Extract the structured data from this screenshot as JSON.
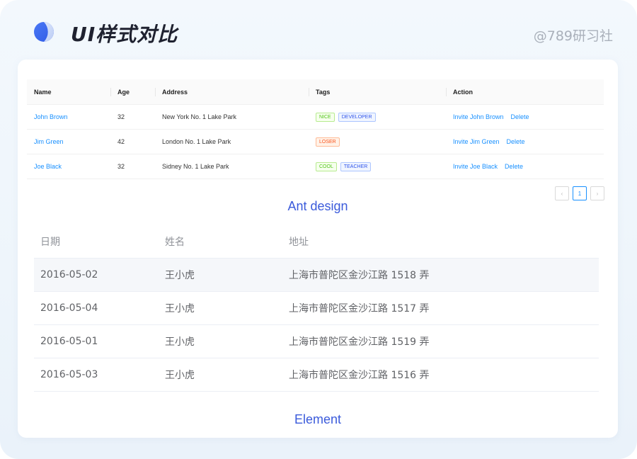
{
  "header": {
    "title": "UI样式对比",
    "credit": "@789研习社",
    "logo": {
      "icon": "half-moon-logo-icon",
      "color": "#3d6cf2"
    }
  },
  "ant": {
    "columns": [
      "Name",
      "Age",
      "Address",
      "Tags",
      "Action"
    ],
    "rows": [
      {
        "name": "John Brown",
        "age": "32",
        "address": "New York No. 1 Lake Park",
        "tags": [
          {
            "label": "NICE",
            "color": "green"
          },
          {
            "label": "DEVELOPER",
            "color": "geekblue"
          }
        ],
        "invite": "Invite John Brown",
        "delete": "Delete"
      },
      {
        "name": "Jim Green",
        "age": "42",
        "address": "London No. 1 Lake Park",
        "tags": [
          {
            "label": "LOSER",
            "color": "volcano"
          }
        ],
        "invite": "Invite Jim Green",
        "delete": "Delete"
      },
      {
        "name": "Joe Black",
        "age": "32",
        "address": "Sidney No. 1 Lake Park",
        "tags": [
          {
            "label": "COOL",
            "color": "green"
          },
          {
            "label": "TEACHER",
            "color": "geekblue"
          }
        ],
        "invite": "Invite Joe Black",
        "delete": "Delete"
      }
    ],
    "pagination": {
      "prev": "‹",
      "current": "1",
      "next": "›"
    },
    "label": "Ant design"
  },
  "element": {
    "columns": [
      "日期",
      "姓名",
      "地址"
    ],
    "rows": [
      {
        "date": "2016-05-02",
        "name": "王小虎",
        "address": "上海市普陀区金沙江路 1518 弄"
      },
      {
        "date": "2016-05-04",
        "name": "王小虎",
        "address": "上海市普陀区金沙江路 1517 弄"
      },
      {
        "date": "2016-05-01",
        "name": "王小虎",
        "address": "上海市普陀区金沙江路 1519 弄"
      },
      {
        "date": "2016-05-03",
        "name": "王小虎",
        "address": "上海市普陀区金沙江路 1516 弄"
      }
    ],
    "label": "Element"
  },
  "colors": {
    "link": "#1890ff",
    "section_label": "#3b5bdb",
    "hover_row": "#f5f7fa"
  }
}
